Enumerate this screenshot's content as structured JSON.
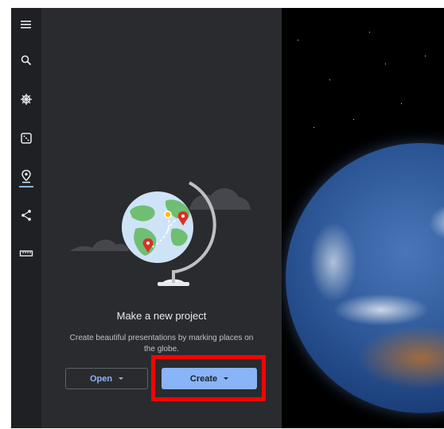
{
  "rail": {
    "items": [
      {
        "name": "menu-icon"
      },
      {
        "name": "search-icon"
      },
      {
        "name": "voyager-icon"
      },
      {
        "name": "feeling-lucky-icon"
      },
      {
        "name": "projects-icon",
        "selected": true
      },
      {
        "name": "share-icon"
      },
      {
        "name": "measure-icon"
      }
    ]
  },
  "project": {
    "title": "Make a new project",
    "description": "Create beautiful presentations by marking places on the globe.",
    "open_label": "Open",
    "create_label": "Create"
  },
  "colors": {
    "accent": "#8ab4f8",
    "panel": "#2a2b2e",
    "rail": "#1f2023",
    "highlight": "#ff0000"
  }
}
